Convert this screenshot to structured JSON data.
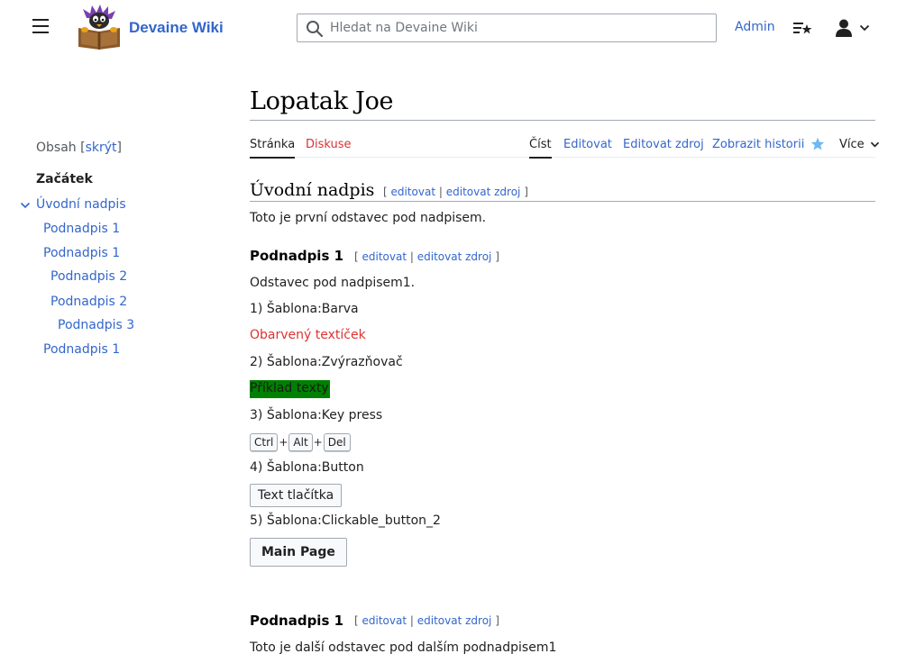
{
  "header": {
    "site_name": "Devaine Wiki",
    "search_placeholder": "Hledat na Devaine Wiki",
    "user_link": "Admin",
    "colors": {
      "link": "#3366cc",
      "text": "#202122"
    }
  },
  "toc": {
    "title": "Obsah",
    "toggle_open": "[",
    "toggle_label": "skrýt",
    "toggle_close": "]",
    "start": "Začátek",
    "items": [
      {
        "label": "Úvodní nadpis",
        "level": 1
      },
      {
        "label": "Podnadpis 1",
        "level": 2
      },
      {
        "label": "Podnadpis 1",
        "level": 2
      },
      {
        "label": "Podnadpis 2",
        "level": 3
      },
      {
        "label": "Podnadpis 2",
        "level": 3
      },
      {
        "label": "Podnadpis 3",
        "level": 4
      },
      {
        "label": "Podnadpis 1",
        "level": 2
      }
    ]
  },
  "page": {
    "title": "Lopatak Joe",
    "tabs": {
      "page": "Stránka",
      "talk": "Diskuse",
      "read": "Číst",
      "edit": "Editovat",
      "edit_source": "Editovat zdroj",
      "history": "Zobrazit historii",
      "more": "Více"
    },
    "edit_labels": {
      "open": "[",
      "edit": "editovat",
      "sep": "|",
      "edit_source": "editovat zdroj",
      "close": "]"
    },
    "sections": {
      "intro_heading": "Úvodní nadpis",
      "intro_para": "Toto je první odstavec pod nadpisem.",
      "sub1_heading": "Podnadpis 1",
      "sub1_para": "Odstavec pod nadpisem1.",
      "tpl1": "1) Šablona:Barva",
      "tpl1_example": "Obarvený textíček",
      "tpl2": "2) Šablona:Zvýrazňovač",
      "tpl2_example": "Příklad texty",
      "tpl3": "3) Šablona:Key press",
      "keys": [
        "Ctrl",
        "Alt",
        "Del"
      ],
      "key_plus": "+",
      "tpl4": "4) Šablona:Button",
      "tpl4_button": "Text tlačítka",
      "tpl5": "5) Šablona:Clickable_button_2",
      "tpl5_button": "Main Page",
      "sub1b_heading": "Podnadpis 1",
      "sub1b_para": "Toto je další odstavec pod dalším podnadpisem1"
    }
  }
}
